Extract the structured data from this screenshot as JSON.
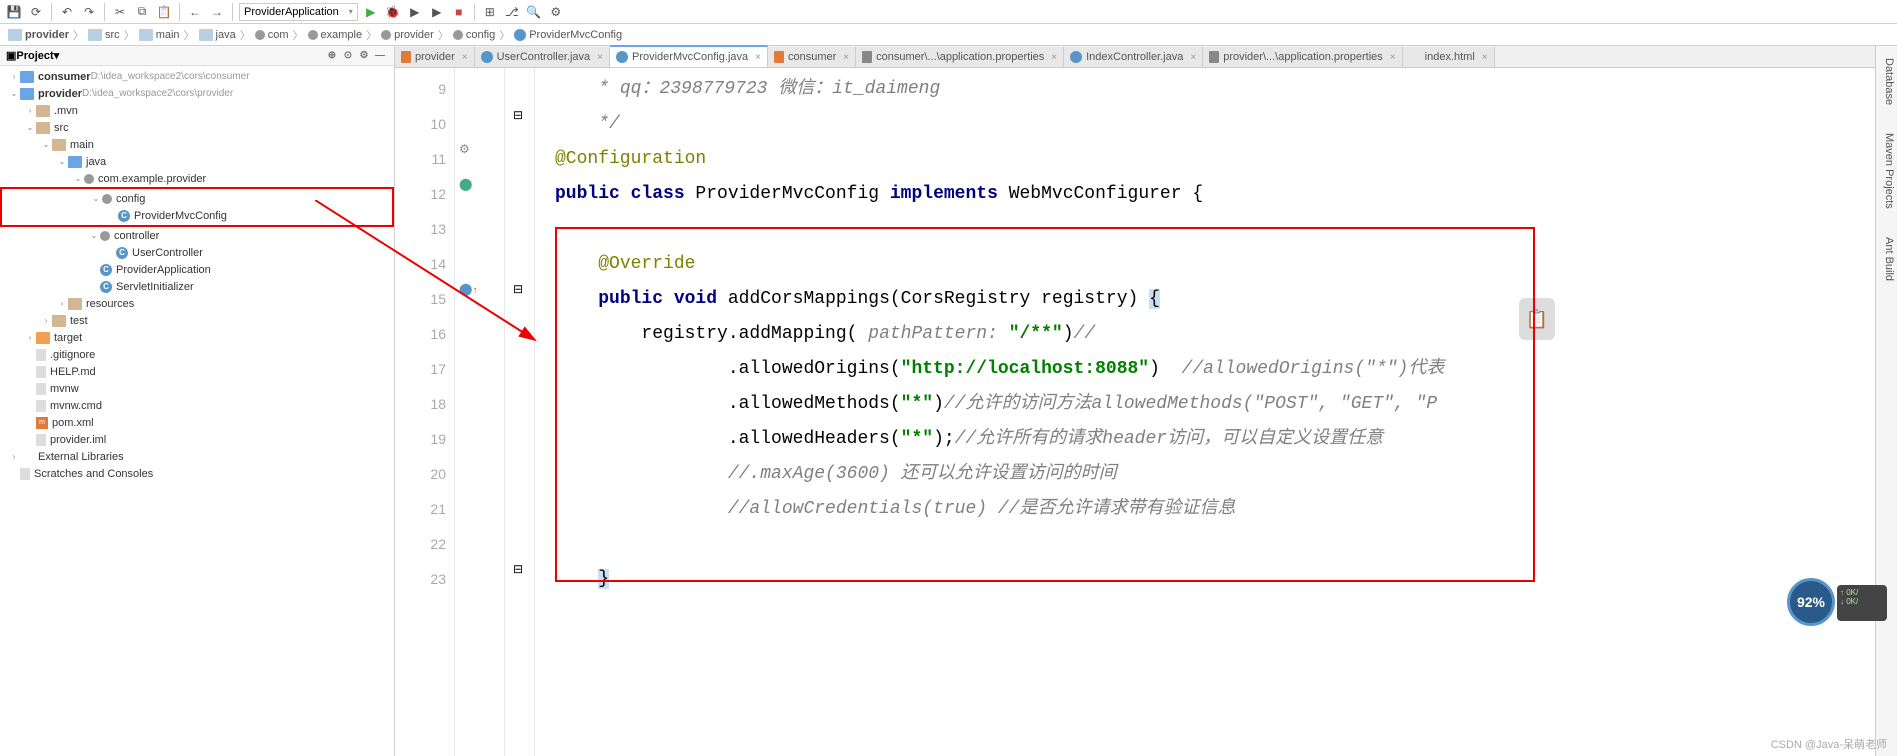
{
  "toolbar": {
    "run_config": "ProviderApplication"
  },
  "breadcrumb": {
    "items": [
      "provider",
      "src",
      "main",
      "java",
      "com",
      "example",
      "provider",
      "config",
      "ProviderMvcConfig"
    ]
  },
  "sidebar": {
    "title": "Project",
    "nodes": [
      {
        "depth": 0,
        "arrow": ">",
        "icon": "folder-o",
        "label": "consumer",
        "suffix": "D:\\idea_workspace2\\cors\\consumer",
        "bold": true
      },
      {
        "depth": 0,
        "arrow": "v",
        "icon": "folder-o",
        "label": "provider",
        "suffix": "D:\\idea_workspace2\\cors\\provider",
        "bold": true
      },
      {
        "depth": 1,
        "arrow": ">",
        "icon": "folder",
        "label": ".mvn"
      },
      {
        "depth": 1,
        "arrow": "v",
        "icon": "folder",
        "label": "src"
      },
      {
        "depth": 2,
        "arrow": "v",
        "icon": "folder",
        "label": "main"
      },
      {
        "depth": 3,
        "arrow": "v",
        "icon": "folder-o",
        "label": "java"
      },
      {
        "depth": 4,
        "arrow": "v",
        "icon": "pkg",
        "label": "com.example.provider"
      },
      {
        "depth": 5,
        "arrow": "v",
        "icon": "pkg",
        "label": "config",
        "redbox": true
      },
      {
        "depth": 6,
        "arrow": "",
        "icon": "java",
        "iconText": "C",
        "label": "ProviderMvcConfig",
        "redbox": true
      },
      {
        "depth": 5,
        "arrow": "v",
        "icon": "pkg",
        "label": "controller"
      },
      {
        "depth": 6,
        "arrow": "",
        "icon": "java",
        "iconText": "C",
        "label": "UserController"
      },
      {
        "depth": 5,
        "arrow": "",
        "icon": "java",
        "iconText": "C",
        "label": "ProviderApplication"
      },
      {
        "depth": 5,
        "arrow": "",
        "icon": "java",
        "iconText": "C",
        "label": "ServletInitializer"
      },
      {
        "depth": 3,
        "arrow": ">",
        "icon": "folder",
        "label": "resources"
      },
      {
        "depth": 2,
        "arrow": ">",
        "icon": "folder",
        "label": "test"
      },
      {
        "depth": 1,
        "arrow": ">",
        "icon": "folder-target",
        "label": "target"
      },
      {
        "depth": 1,
        "arrow": "",
        "icon": "file",
        "label": ".gitignore"
      },
      {
        "depth": 1,
        "arrow": "",
        "icon": "file",
        "label": "HELP.md"
      },
      {
        "depth": 1,
        "arrow": "",
        "icon": "file",
        "label": "mvnw"
      },
      {
        "depth": 1,
        "arrow": "",
        "icon": "file",
        "label": "mvnw.cmd"
      },
      {
        "depth": 1,
        "arrow": "",
        "icon": "xml",
        "iconText": "m",
        "label": "pom.xml"
      },
      {
        "depth": 1,
        "arrow": "",
        "icon": "file",
        "label": "provider.iml"
      },
      {
        "depth": 0,
        "arrow": ">",
        "icon": "lib",
        "label": "External Libraries"
      },
      {
        "depth": 0,
        "arrow": "",
        "icon": "file",
        "label": "Scratches and Consoles"
      }
    ]
  },
  "tabs": [
    {
      "icon": "m",
      "label": "provider"
    },
    {
      "icon": "java",
      "label": "UserController.java"
    },
    {
      "icon": "java",
      "label": "ProviderMvcConfig.java",
      "active": true
    },
    {
      "icon": "m",
      "label": "consumer"
    },
    {
      "icon": "prop",
      "label": "consumer\\...\\application.properties"
    },
    {
      "icon": "java",
      "label": "IndexController.java"
    },
    {
      "icon": "prop",
      "label": "provider\\...\\application.properties"
    },
    {
      "icon": "file",
      "label": "index.html"
    }
  ],
  "editor": {
    "lines": [
      {
        "n": 9,
        "html": "    <span class='c-cmt'>* qq：2398779723 微信：it_daimeng</span>"
      },
      {
        "n": 10,
        "html": "    <span class='c-cmt'>*/</span>"
      },
      {
        "n": 11,
        "html": "<span class='c-ann'>@Configuration</span>"
      },
      {
        "n": 12,
        "html": "<span class='c-kw'>public class</span> ProviderMvcConfig <span class='c-kw'>implements</span> WebMvcConfigurer {"
      },
      {
        "n": 13,
        "html": ""
      },
      {
        "n": 14,
        "html": "    <span class='c-ann'>@Override</span>"
      },
      {
        "n": 15,
        "html": "    <span class='c-kw'>public void</span> addCorsMappings(CorsRegistry registry) <span class='c-sel'>{</span>"
      },
      {
        "n": 16,
        "html": "        registry.addMapping( <span class='c-param'>pathPattern:</span> <span class='c-str'>\"/**\"</span>)<span class='c-cmt'>//</span>"
      },
      {
        "n": 17,
        "html": "                .allowedOrigins(<span class='c-str'>\"http://localhost:8088\"</span>)  <span class='c-cmt'>//allowedOrigins(\"*\")代表</span>"
      },
      {
        "n": 18,
        "html": "                .allowedMethods(<span class='c-str'>\"*\"</span>)<span class='c-cmt'>//允许的访问方法allowedMethods(\"POST\", \"GET\", \"P</span>"
      },
      {
        "n": 19,
        "html": "                .allowedHeaders(<span class='c-str'>\"*\"</span>);<span class='c-cmt'>//允许所有的请求header访问，可以自定义设置任意</span>"
      },
      {
        "n": 20,
        "html": "                <span class='c-cmt'>//.maxAge(3600) 还可以允许设置访问的时间</span>"
      },
      {
        "n": 21,
        "html": "                <span class='c-cmt'>//allowCredentials(true) //是否允许请求带有验证信息</span>"
      },
      {
        "n": 22,
        "html": ""
      },
      {
        "n": 23,
        "html": "    <span class='c-sel'>}</span>"
      }
    ]
  },
  "rightbar": {
    "items": [
      "Database",
      "Maven Projects",
      "Ant Build"
    ]
  },
  "badge": {
    "value": "92%",
    "l1": "↑ 0K/",
    "l2": "↓ 0K/"
  },
  "watermark": "CSDN @Java-呆萌老师"
}
